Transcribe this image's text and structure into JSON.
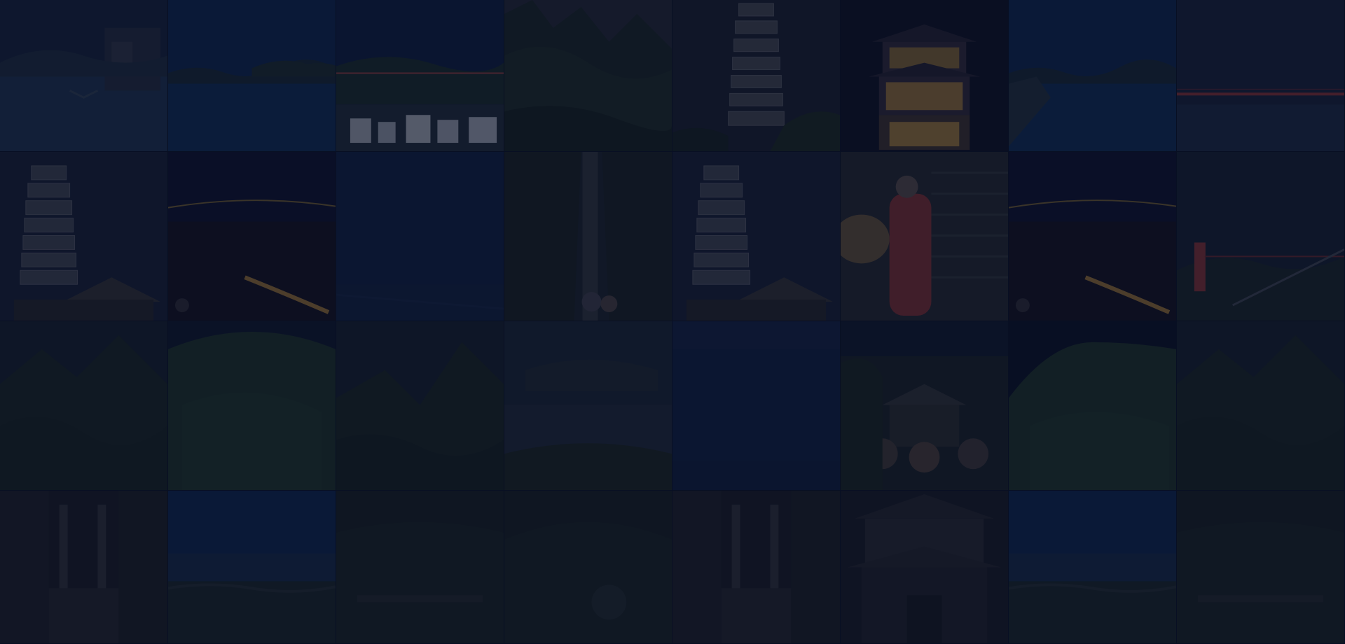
{
  "tiles": [
    {
      "icon": "lake-village-photo"
    },
    {
      "icon": "river-photo"
    },
    {
      "icon": "riverside-village-photo"
    },
    {
      "icon": "misty-mountain-photo"
    },
    {
      "icon": "pagoda-photo"
    },
    {
      "icon": "lit-pavilion-night-photo"
    },
    {
      "icon": "river-photo"
    },
    {
      "icon": "bridge-photo"
    },
    {
      "icon": "pagoda-photo"
    },
    {
      "icon": "night-valley-photo"
    },
    {
      "icon": "dark-sky-photo"
    },
    {
      "icon": "waterfall-photo"
    },
    {
      "icon": "pagoda-photo"
    },
    {
      "icon": "woman-red-dress-photo"
    },
    {
      "icon": "night-valley-photo"
    },
    {
      "icon": "bridge-tower-photo"
    },
    {
      "icon": "forest-mountain-photo"
    },
    {
      "icon": "green-cliff-photo"
    },
    {
      "icon": "forest-mountain-photo"
    },
    {
      "icon": "misty-lake-photo"
    },
    {
      "icon": "dark-sky-photo"
    },
    {
      "icon": "village-people-photo"
    },
    {
      "icon": "green-cliff-photo"
    },
    {
      "icon": "forest-mountain-photo"
    },
    {
      "icon": "old-street-photo"
    },
    {
      "icon": "coastline-photo"
    },
    {
      "icon": "dark-forest-photo"
    },
    {
      "icon": "dark-forest-photo"
    },
    {
      "icon": "old-street-photo"
    },
    {
      "icon": "temple-gate-photo"
    },
    {
      "icon": "coastline-photo"
    },
    {
      "icon": "dark-forest-photo"
    }
  ],
  "palette": {
    "background": "#0a1226",
    "overlay": "#080e22",
    "sky": "#1b2c4f",
    "water": "#1d3a66",
    "forest": "#1a2a2a",
    "gold": "#d3a44b",
    "red": "#a33b3b"
  }
}
